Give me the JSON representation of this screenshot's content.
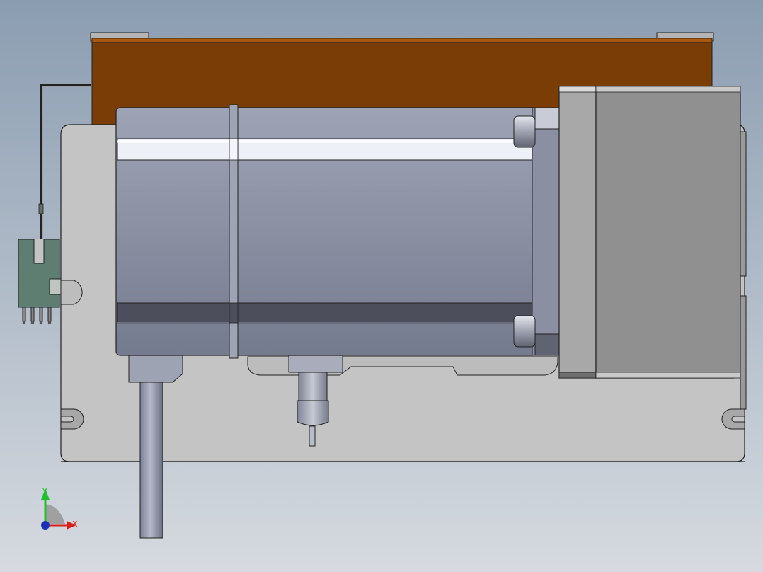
{
  "viewport": {
    "background_top": "#8a9cb0",
    "background_bottom": "#d5d9df"
  },
  "model": {
    "parts": [
      "orange-top-panel",
      "grey-base-plate",
      "motor-body",
      "gearbox-block",
      "green-connector",
      "motor-cable",
      "shaft-pin",
      "wire-harness"
    ],
    "colors": {
      "orange_panel": "#7a3d06",
      "plate": "#c3c3c3",
      "motor": "#868c9e",
      "gearbox": "#919191",
      "connector": "#5f7e72",
      "edge": "#202020"
    }
  },
  "triad": {
    "x_label": "X",
    "y_label": "Y",
    "x_color": "#d81f1f",
    "y_color": "#1fbf2f",
    "z_color": "#1c2fb8"
  }
}
